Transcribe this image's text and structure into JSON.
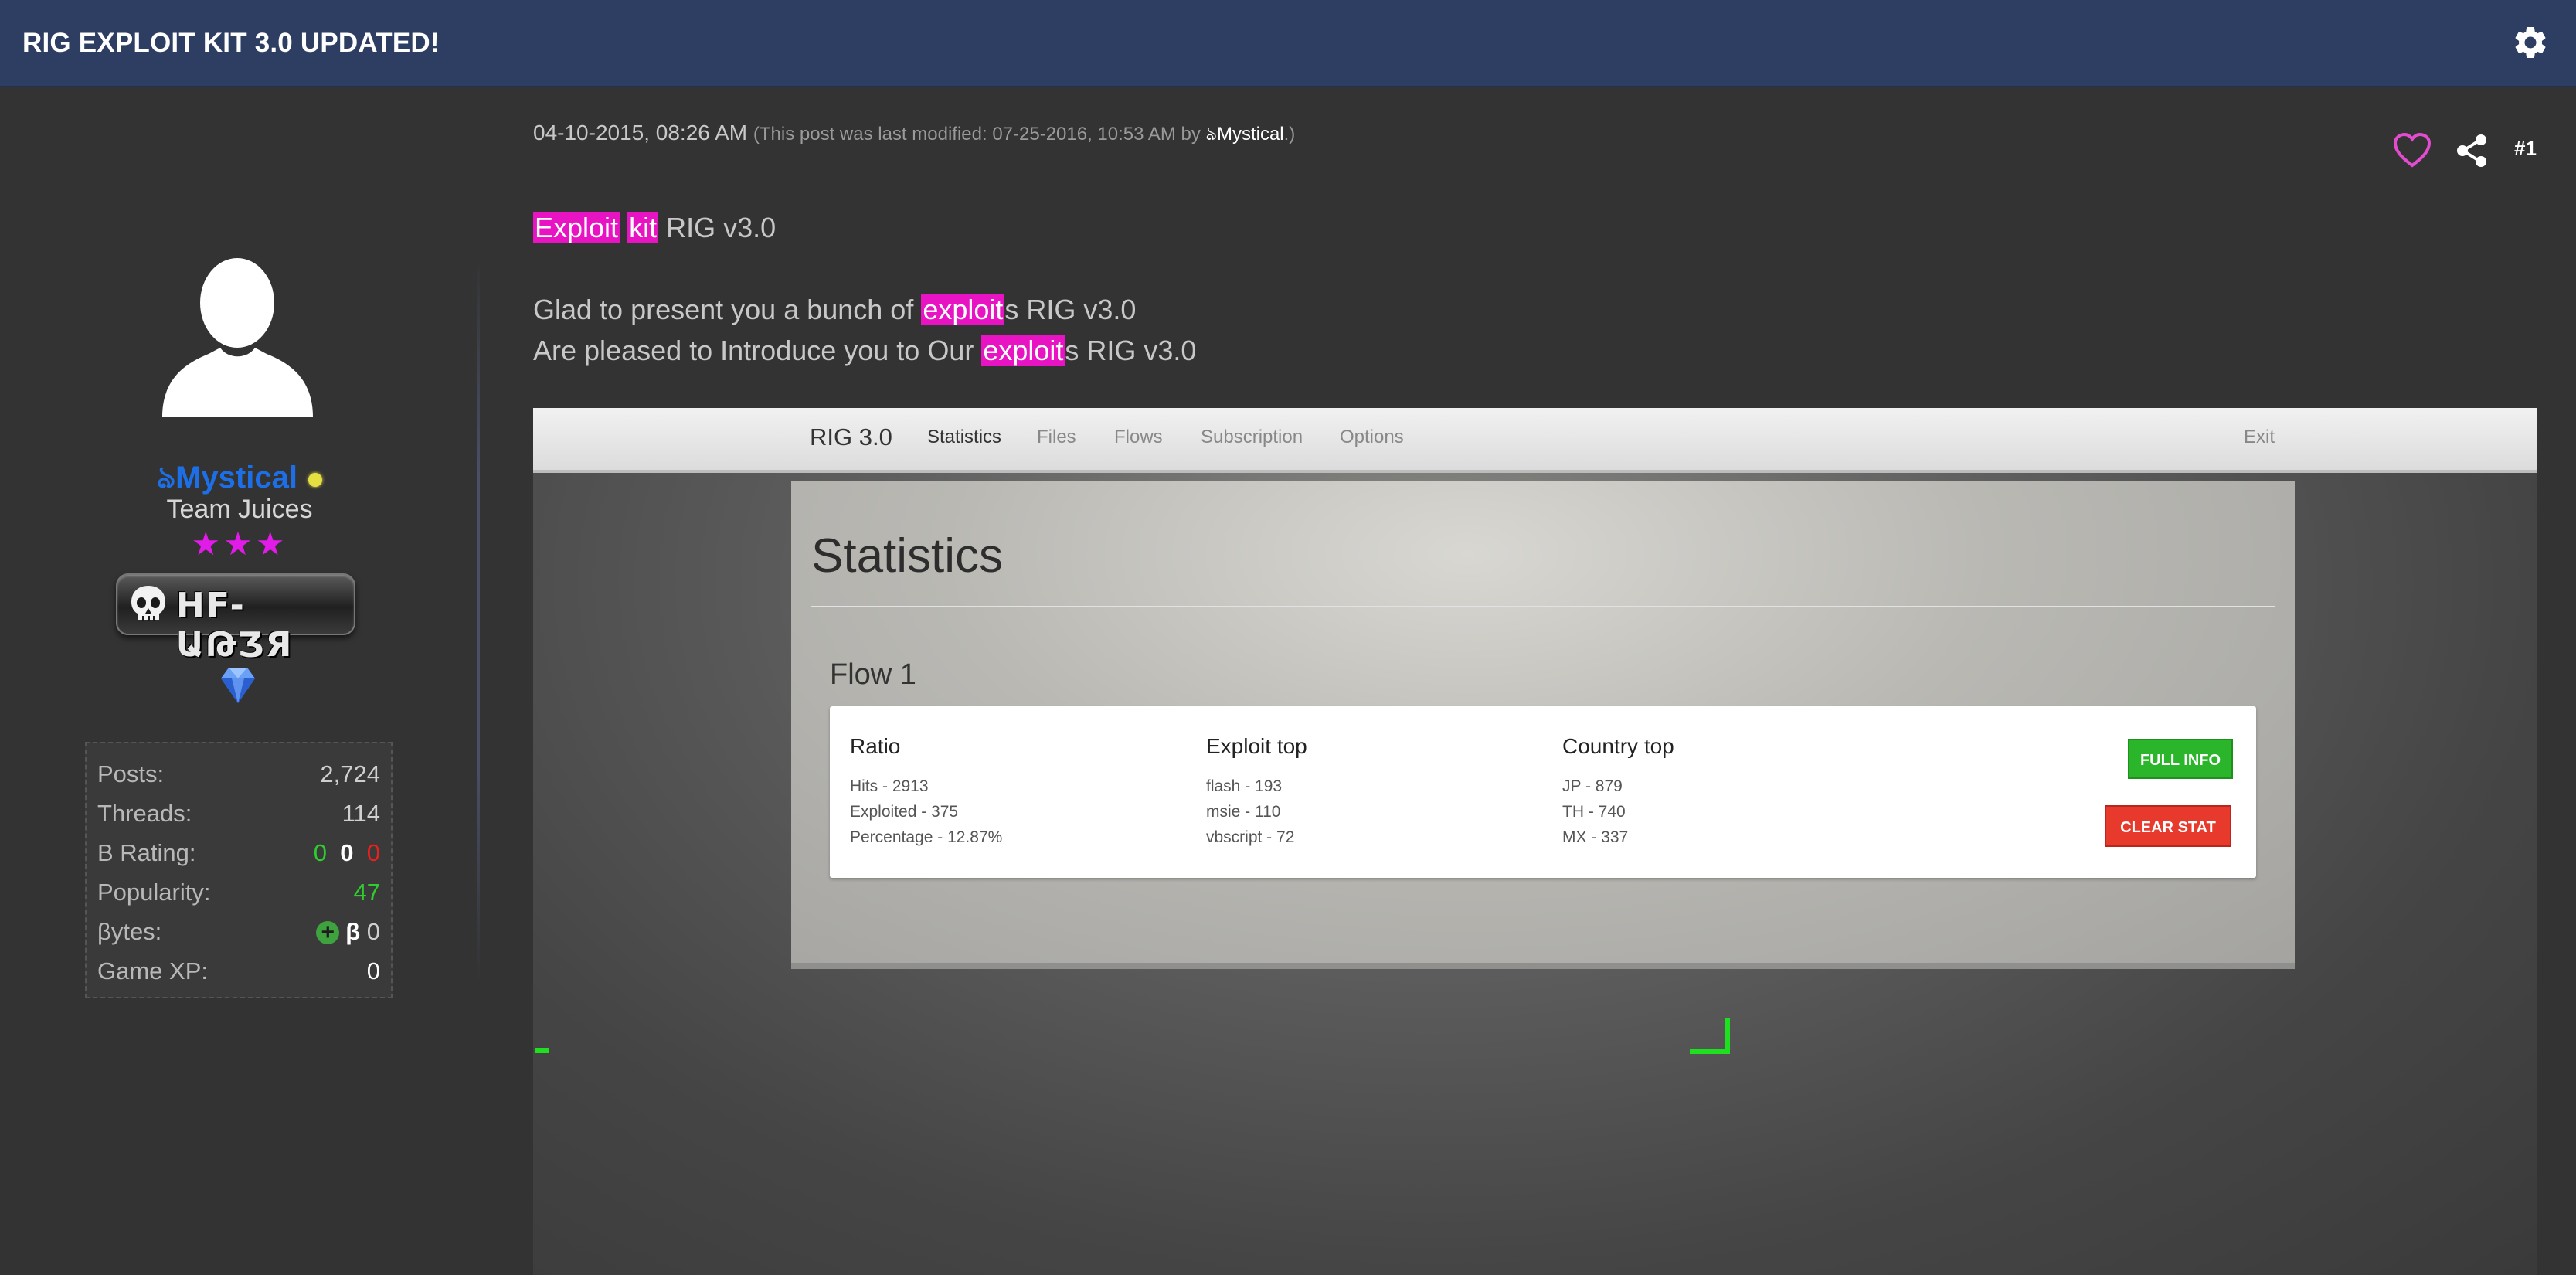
{
  "header": {
    "title": "RIG EXPLOIT KIT 3.0 UPDATED!",
    "settings_icon": "gear-icon"
  },
  "user": {
    "name": "Mystical",
    "name_prefix": "ঌ",
    "online_status_color": "#e5df41",
    "group": "Team Juices",
    "stars": "★★★",
    "badge_text": "HF-ԱԹƷЯ",
    "stats": [
      {
        "label": "Posts:",
        "value": "2,724"
      },
      {
        "label": "Threads:",
        "value": "114"
      },
      {
        "label": "B Rating:",
        "value_green": "0",
        "value_white": "0",
        "value_red": "0"
      },
      {
        "label": "Popularity:",
        "value": "47"
      },
      {
        "label": "βytes:",
        "value_symbol": "β",
        "value": "0"
      },
      {
        "label": "Game XP:",
        "value": "0"
      }
    ]
  },
  "post": {
    "date": "04-10-2015, 08:26 AM",
    "edit_note_prefix": "(This post was last modified: 07-25-2016, 10:53 AM by ",
    "edit_note_editor": "ঌMystical",
    "edit_note_suffix": ".)",
    "number": "#1",
    "line1": {
      "hl1": "Exploit",
      "hl2": "kit",
      "rest": " RIG v3.0"
    },
    "line2": {
      "before": "Glad to present you a bunch of ",
      "hl": "exploit",
      "after": "s RIG v3.0"
    },
    "line3": {
      "before": "Are pleased to Introduce you to Our ",
      "hl": "exploit",
      "after": "s RIG v3.0"
    }
  },
  "screenshot": {
    "brand": "RIG 3.0",
    "nav": [
      "Statistics",
      "Files",
      "Flows",
      "Subscription",
      "Options"
    ],
    "exit": "Exit",
    "heading": "Statistics",
    "flow_title": "Flow 1",
    "columns": [
      {
        "title": "Ratio",
        "lines": [
          "Hits - 2913",
          "Exploited - 375",
          "Percentage - 12.87%"
        ]
      },
      {
        "title": "Exploit top",
        "lines": [
          "flash - 193",
          "msie - 110",
          "vbscript - 72"
        ]
      },
      {
        "title": "Country top",
        "lines": [
          "JP - 879",
          "TH - 740",
          "MX - 337"
        ]
      }
    ],
    "full_info_button": "FULL INFO",
    "clear_stat_button": "CLEAR STAT"
  },
  "colors": {
    "header_bg": "#2e3e63",
    "highlight": "#e813c2",
    "username": "#1d6fe8",
    "stars": "#e11be8"
  }
}
